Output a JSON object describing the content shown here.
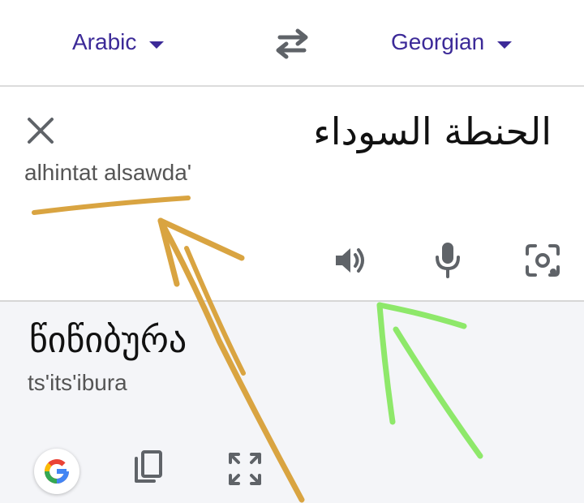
{
  "language_bar": {
    "source_language": "Arabic",
    "target_language": "Georgian"
  },
  "input": {
    "source_text": "الحنطة السوداء",
    "transliteration": "alhintat alsawda'"
  },
  "output": {
    "translation": "წიწიბურა",
    "transliteration": "ts'its'ibura"
  },
  "colors": {
    "accent": "#3c2a98",
    "icon_gray": "#5f6368",
    "annotation_orange": "#d9a441",
    "annotation_green": "#8ee86a"
  }
}
